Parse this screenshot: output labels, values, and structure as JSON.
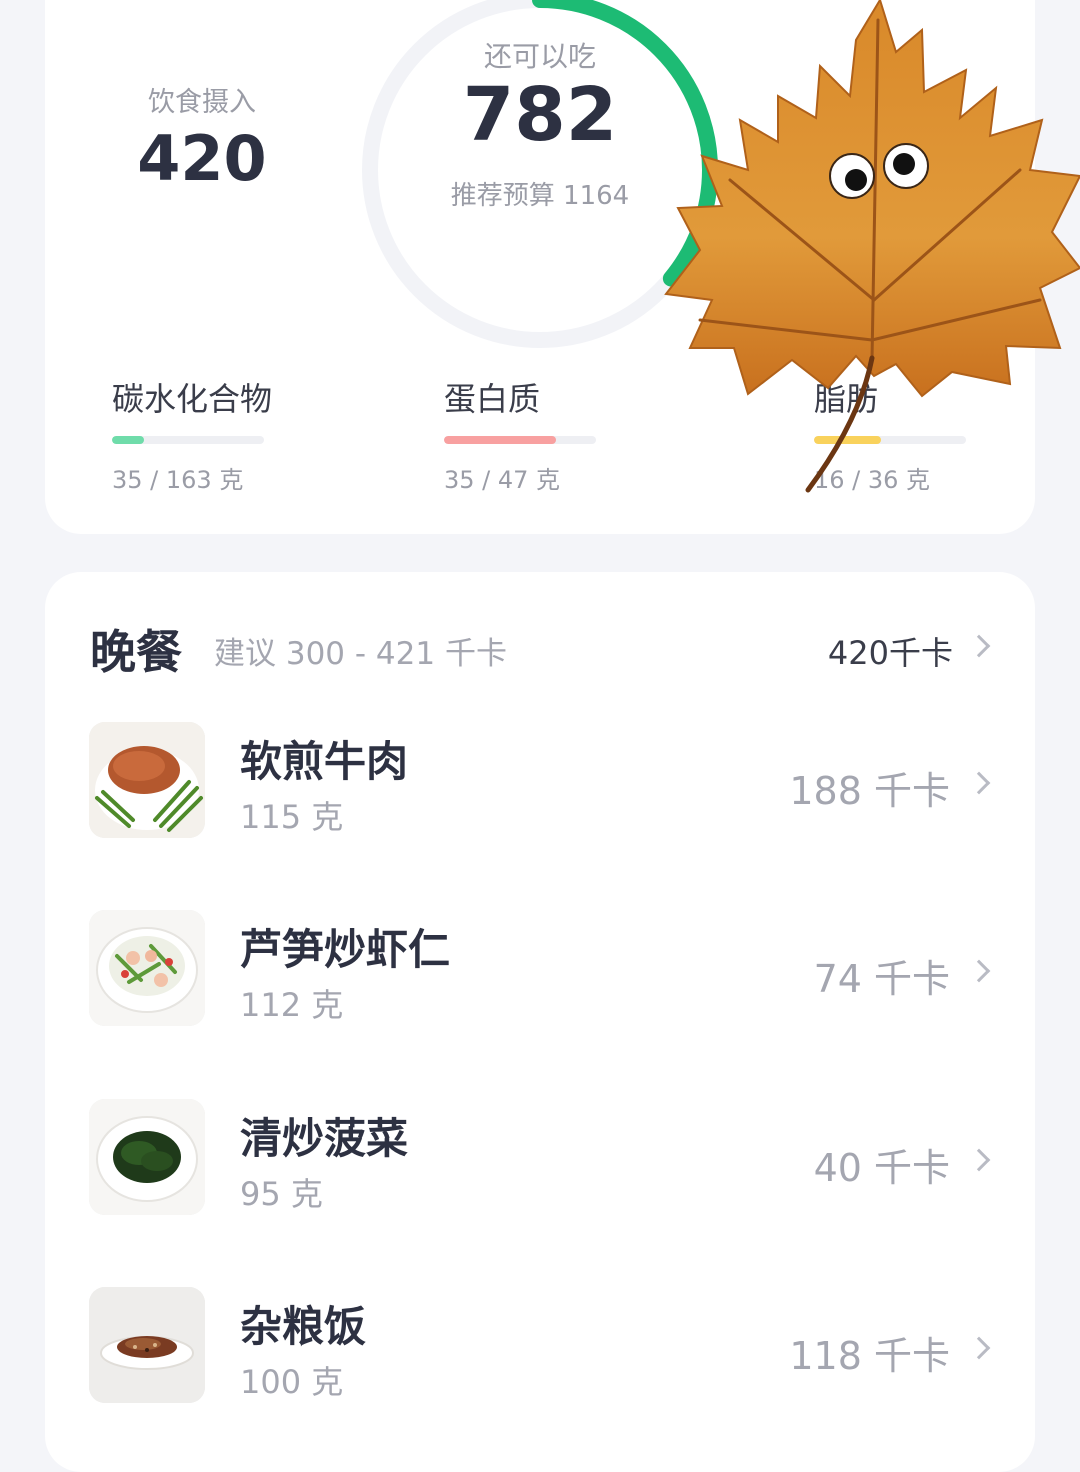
{
  "summary": {
    "intake_label": "饮食摄入",
    "intake_value": "420",
    "remaining_label": "还可以吃",
    "remaining_value": "782",
    "budget_text": "推荐预算 1164",
    "ring_progress": 0.36,
    "ring_color": "#1dbb74",
    "macros": [
      {
        "name": "碳水化合物",
        "amount": "35 / 163 克",
        "progress": 0.21,
        "color": "#6fdcaa"
      },
      {
        "name": "蛋白质",
        "amount": "35 / 47 克",
        "progress": 0.74,
        "color": "#f8a0a0"
      },
      {
        "name": "脂肪",
        "amount": "16 / 36 克",
        "progress": 0.44,
        "color": "#f9d25c"
      }
    ]
  },
  "meal": {
    "title": "晚餐",
    "suggestion": "建议 300 - 421 千卡",
    "total": "420千卡",
    "foods": [
      {
        "name": "软煎牛肉",
        "weight": "115 克",
        "kcal": "188 千卡",
        "image": "pan-fried-beef-with-asparagus"
      },
      {
        "name": "芦笋炒虾仁",
        "weight": "112 克",
        "kcal": "74 千卡",
        "image": "asparagus-shrimp-plate"
      },
      {
        "name": "清炒菠菜",
        "weight": "95 克",
        "kcal": "40 千卡",
        "image": "stir-fried-spinach-plate"
      },
      {
        "name": "杂粮饭",
        "weight": "100 克",
        "kcal": "118 千卡",
        "image": "mixed-grain-rice-plate"
      }
    ]
  },
  "overlay": {
    "sticker": "maple-leaf-with-googly-eyes"
  }
}
